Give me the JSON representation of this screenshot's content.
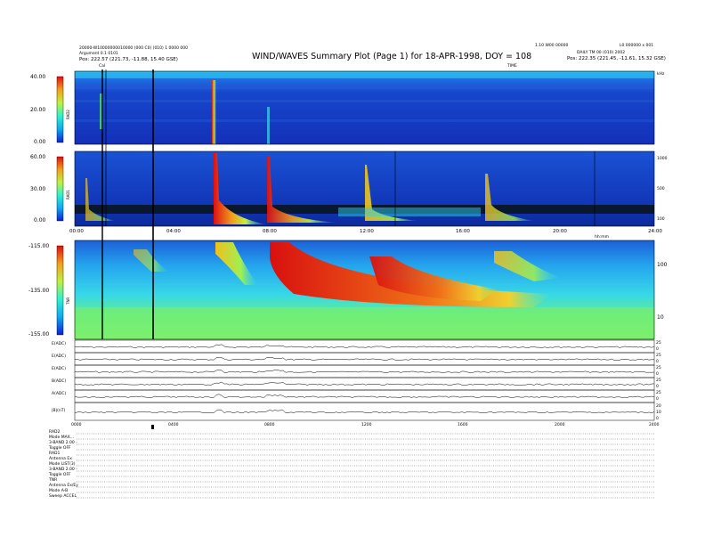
{
  "header": {
    "title": "WIND/WAVES Summary Plot (Page 1) for 18-APR-1998, DOY = 108",
    "left_line1": "20000-W10000000010000 (000 C0) (010) 1 0000 000",
    "left_line2": "Argument 0.1 0101",
    "left_line3": "Pos: 222.57 (221.73, -11.88, 15.40 GSE)",
    "right_line1": "1.10 W00 00000",
    "right_line2": "L0 000000 x 001",
    "right_line3": "DAILY TM 00 (010) 2002",
    "right_line4": "Pos: 222.35 (221.45, -11.61, 15.32 GSE)",
    "axis_marker_left": "Cal",
    "axis_marker_right_top": "TIME",
    "axis_marker_far_right": "kHz"
  },
  "colors": {
    "bg_blue": "#1540c8",
    "low_cyan": "#32d6f0",
    "mid_green": "#3af070",
    "high_yellow": "#f0e020",
    "peak_red": "#e01010",
    "dropout_black": "#000000"
  },
  "colorbars": {
    "rad2": {
      "label": "RAD2",
      "ticks": [
        "40.00",
        "20.00",
        "0.00"
      ]
    },
    "rad1": {
      "label": "RAD1",
      "ticks": [
        "60.00",
        "30.00",
        "0.00"
      ]
    },
    "tnr": {
      "label": "TNR",
      "ticks": [
        "-115.00",
        "-135.00",
        "-155.00"
      ]
    }
  },
  "chart_data": [
    {
      "type": "heatmap",
      "panel": "RAD2",
      "colorbar_range": [
        0,
        40
      ],
      "x_range_hours": [
        0,
        24
      ],
      "features": "Mostly uniform background; strong burst near 05:40 UT and weaker near 09:00 UT"
    },
    {
      "type": "heatmap",
      "panel": "RAD1",
      "colorbar_range": [
        0,
        60
      ],
      "x_range_hours": [
        0,
        24
      ],
      "right_ticks": [
        "1000",
        "500",
        "100"
      ],
      "time_ticks": [
        "00:00",
        "04:00",
        "08:00",
        "12:00",
        "16:00",
        "20:00",
        "24:00"
      ],
      "axis_title": "hh:mm",
      "burst_times_hhmm": [
        "01:00",
        "03:30",
        "05:40",
        "08:50",
        "12:40",
        "16:40",
        "19:50"
      ]
    },
    {
      "type": "heatmap",
      "panel": "TNR",
      "colorbar_range": [
        -155,
        -115
      ],
      "x_range_hours": [
        0,
        24
      ],
      "right_ticks": [
        "100",
        "10"
      ],
      "features": "Type III bursts drifting to low frequency near 05:40, 08:50, 12:30 UT"
    },
    {
      "type": "line",
      "panels": [
        {
          "label": "E(ADC)",
          "right_ticks": [
            "25",
            "0"
          ]
        },
        {
          "label": "E(ADC)",
          "right_ticks": [
            "25",
            "0"
          ]
        },
        {
          "label": "E(ADC)",
          "right_ticks": [
            "25",
            "0"
          ]
        },
        {
          "label": "B(ADC)",
          "right_ticks": [
            "25",
            "0"
          ]
        },
        {
          "label": "A(ADC)",
          "right_ticks": [
            "25",
            "0"
          ]
        },
        {
          "label": "|B|(nT)",
          "right_ticks": [
            "20",
            "10",
            "0"
          ]
        }
      ],
      "time_ticks": [
        "0000",
        "0400",
        "0800",
        "1200",
        "1600",
        "2000",
        "2400"
      ]
    }
  ],
  "footer": {
    "rows": [
      "RAD2",
      "Mode  MAX...",
      "3-BAND 2.00 -",
      "Toggle    OFF",
      "RAD1",
      "Antenna     Ex",
      "Mode  LIST(3)",
      "3-BAND 2.00 -",
      "Toggle    OFF",
      "TNR",
      "Antenna    Ex/Ey",
      "Mode      A-B",
      "Sweep ACCEL"
    ]
  }
}
